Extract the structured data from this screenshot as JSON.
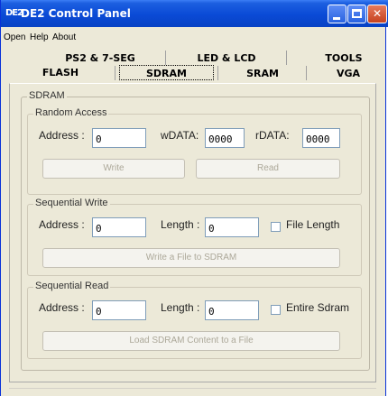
{
  "window": {
    "logo": "DE2",
    "title": "DE2 Control Panel"
  },
  "menu": [
    "Open",
    "Help",
    "About"
  ],
  "tabs_row1": [
    "PS2 & 7-SEG",
    "LED & LCD",
    "TOOLS"
  ],
  "tabs_row2": [
    "FLASH",
    "SDRAM",
    "SRAM",
    "VGA"
  ],
  "active_tab": "SDRAM",
  "panel": {
    "title": "SDRAM"
  },
  "random_access": {
    "title": "Random Access",
    "address_label": "Address :",
    "address_value": "0",
    "wdata_label": "wDATA:",
    "wdata_value": "0000",
    "rdata_label": "rDATA:",
    "rdata_value": "0000",
    "write_label": "Write",
    "read_label": "Read"
  },
  "sequential_write": {
    "title": "Sequential Write",
    "address_label": "Address :",
    "address_value": "0",
    "length_label": "Length :",
    "length_value": "0",
    "checkbox_label": "File Length",
    "button_label": "Write a File to SDRAM"
  },
  "sequential_read": {
    "title": "Sequential Read",
    "address_label": "Address :",
    "address_value": "0",
    "length_label": "Length :",
    "length_value": "0",
    "checkbox_label": "Entire Sdram",
    "button_label": "Load SDRAM Content to a File"
  }
}
